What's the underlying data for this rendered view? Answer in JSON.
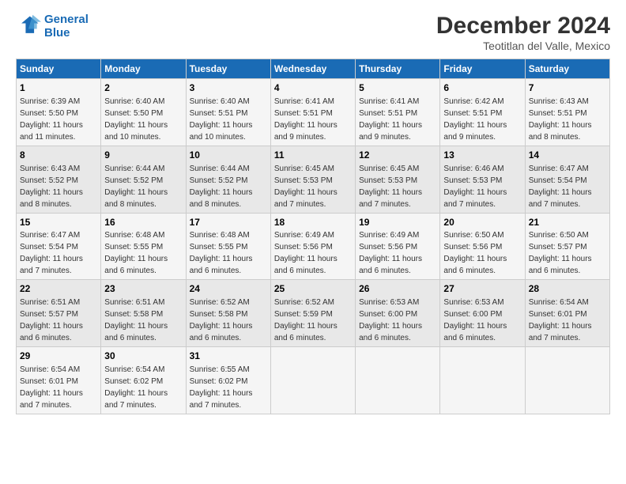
{
  "logo": {
    "line1": "General",
    "line2": "Blue"
  },
  "title": "December 2024",
  "subtitle": "Teotitlan del Valle, Mexico",
  "headers": [
    "Sunday",
    "Monday",
    "Tuesday",
    "Wednesday",
    "Thursday",
    "Friday",
    "Saturday"
  ],
  "weeks": [
    [
      {
        "day": "1",
        "info": "Sunrise: 6:39 AM\nSunset: 5:50 PM\nDaylight: 11 hours\nand 11 minutes."
      },
      {
        "day": "2",
        "info": "Sunrise: 6:40 AM\nSunset: 5:50 PM\nDaylight: 11 hours\nand 10 minutes."
      },
      {
        "day": "3",
        "info": "Sunrise: 6:40 AM\nSunset: 5:51 PM\nDaylight: 11 hours\nand 10 minutes."
      },
      {
        "day": "4",
        "info": "Sunrise: 6:41 AM\nSunset: 5:51 PM\nDaylight: 11 hours\nand 9 minutes."
      },
      {
        "day": "5",
        "info": "Sunrise: 6:41 AM\nSunset: 5:51 PM\nDaylight: 11 hours\nand 9 minutes."
      },
      {
        "day": "6",
        "info": "Sunrise: 6:42 AM\nSunset: 5:51 PM\nDaylight: 11 hours\nand 9 minutes."
      },
      {
        "day": "7",
        "info": "Sunrise: 6:43 AM\nSunset: 5:51 PM\nDaylight: 11 hours\nand 8 minutes."
      }
    ],
    [
      {
        "day": "8",
        "info": "Sunrise: 6:43 AM\nSunset: 5:52 PM\nDaylight: 11 hours\nand 8 minutes."
      },
      {
        "day": "9",
        "info": "Sunrise: 6:44 AM\nSunset: 5:52 PM\nDaylight: 11 hours\nand 8 minutes."
      },
      {
        "day": "10",
        "info": "Sunrise: 6:44 AM\nSunset: 5:52 PM\nDaylight: 11 hours\nand 8 minutes."
      },
      {
        "day": "11",
        "info": "Sunrise: 6:45 AM\nSunset: 5:53 PM\nDaylight: 11 hours\nand 7 minutes."
      },
      {
        "day": "12",
        "info": "Sunrise: 6:45 AM\nSunset: 5:53 PM\nDaylight: 11 hours\nand 7 minutes."
      },
      {
        "day": "13",
        "info": "Sunrise: 6:46 AM\nSunset: 5:53 PM\nDaylight: 11 hours\nand 7 minutes."
      },
      {
        "day": "14",
        "info": "Sunrise: 6:47 AM\nSunset: 5:54 PM\nDaylight: 11 hours\nand 7 minutes."
      }
    ],
    [
      {
        "day": "15",
        "info": "Sunrise: 6:47 AM\nSunset: 5:54 PM\nDaylight: 11 hours\nand 7 minutes."
      },
      {
        "day": "16",
        "info": "Sunrise: 6:48 AM\nSunset: 5:55 PM\nDaylight: 11 hours\nand 6 minutes."
      },
      {
        "day": "17",
        "info": "Sunrise: 6:48 AM\nSunset: 5:55 PM\nDaylight: 11 hours\nand 6 minutes."
      },
      {
        "day": "18",
        "info": "Sunrise: 6:49 AM\nSunset: 5:56 PM\nDaylight: 11 hours\nand 6 minutes."
      },
      {
        "day": "19",
        "info": "Sunrise: 6:49 AM\nSunset: 5:56 PM\nDaylight: 11 hours\nand 6 minutes."
      },
      {
        "day": "20",
        "info": "Sunrise: 6:50 AM\nSunset: 5:56 PM\nDaylight: 11 hours\nand 6 minutes."
      },
      {
        "day": "21",
        "info": "Sunrise: 6:50 AM\nSunset: 5:57 PM\nDaylight: 11 hours\nand 6 minutes."
      }
    ],
    [
      {
        "day": "22",
        "info": "Sunrise: 6:51 AM\nSunset: 5:57 PM\nDaylight: 11 hours\nand 6 minutes."
      },
      {
        "day": "23",
        "info": "Sunrise: 6:51 AM\nSunset: 5:58 PM\nDaylight: 11 hours\nand 6 minutes."
      },
      {
        "day": "24",
        "info": "Sunrise: 6:52 AM\nSunset: 5:58 PM\nDaylight: 11 hours\nand 6 minutes."
      },
      {
        "day": "25",
        "info": "Sunrise: 6:52 AM\nSunset: 5:59 PM\nDaylight: 11 hours\nand 6 minutes."
      },
      {
        "day": "26",
        "info": "Sunrise: 6:53 AM\nSunset: 6:00 PM\nDaylight: 11 hours\nand 6 minutes."
      },
      {
        "day": "27",
        "info": "Sunrise: 6:53 AM\nSunset: 6:00 PM\nDaylight: 11 hours\nand 6 minutes."
      },
      {
        "day": "28",
        "info": "Sunrise: 6:54 AM\nSunset: 6:01 PM\nDaylight: 11 hours\nand 7 minutes."
      }
    ],
    [
      {
        "day": "29",
        "info": "Sunrise: 6:54 AM\nSunset: 6:01 PM\nDaylight: 11 hours\nand 7 minutes."
      },
      {
        "day": "30",
        "info": "Sunrise: 6:54 AM\nSunset: 6:02 PM\nDaylight: 11 hours\nand 7 minutes."
      },
      {
        "day": "31",
        "info": "Sunrise: 6:55 AM\nSunset: 6:02 PM\nDaylight: 11 hours\nand 7 minutes."
      },
      {
        "day": "",
        "info": ""
      },
      {
        "day": "",
        "info": ""
      },
      {
        "day": "",
        "info": ""
      },
      {
        "day": "",
        "info": ""
      }
    ]
  ]
}
